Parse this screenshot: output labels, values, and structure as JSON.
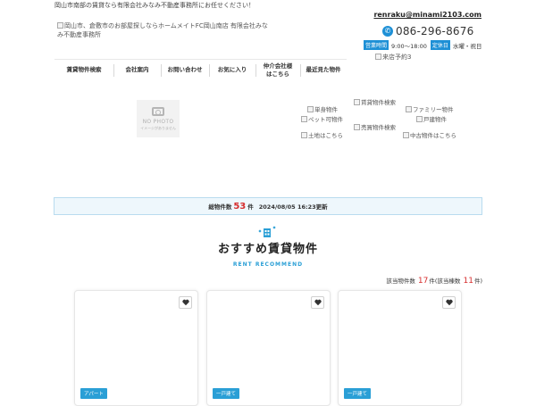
{
  "header": {
    "tagline": "岡山市南部の賃貸なら有限会社みなみ不動産事務所にお任せください！",
    "email": "renraku@minami2103.com",
    "logo_alt": "岡山市、倉敷市のお部屋探しならホームメイトFC岡山南店 有限会社みなみ不動産事務所",
    "phone": "086-296-8676",
    "hours_label": "営業時間",
    "hours_value": "9:00～18:00",
    "holiday_label": "定休日",
    "holiday_value": "水曜・祝日",
    "visit_alt": "来店予約3"
  },
  "nav": {
    "items": [
      {
        "label": "賃貸物件検索"
      },
      {
        "label": "会社案内"
      },
      {
        "label": "お問い合わせ"
      },
      {
        "label": "お気に入り"
      },
      {
        "label": "仲介会社様はこちら"
      },
      {
        "label": "最近見た物件"
      }
    ]
  },
  "no_photo": {
    "title": "NO PHOTO",
    "subtitle": "イメージがありません"
  },
  "categories": {
    "rent_search": "賃貸物件検索",
    "single": "単身物件",
    "family": "ファミリー物件",
    "pet": "ペット可物件",
    "house": "戸建物件",
    "sale": "売買物件検索",
    "land": "土地はこちら",
    "used": "中古物件はこちら"
  },
  "stats": {
    "label": "総物件数",
    "count": "53",
    "unit": "件",
    "updated": "2024/08/05 16:23更新"
  },
  "recommend": {
    "title": "おすすめ賃貸物件",
    "subtitle": "RENT RECOMMEND",
    "count_prefix": "該当物件数",
    "count": "17",
    "count_suffix": "件(該当棟数",
    "buildings": "11",
    "buildings_suffix": "件)"
  },
  "cards": [
    {
      "badge": "アパート"
    },
    {
      "badge": "一戸建て"
    },
    {
      "badge": "一戸建て"
    }
  ],
  "colors": {
    "accent": "#2a9fd6",
    "highlight": "#d62d2d"
  }
}
